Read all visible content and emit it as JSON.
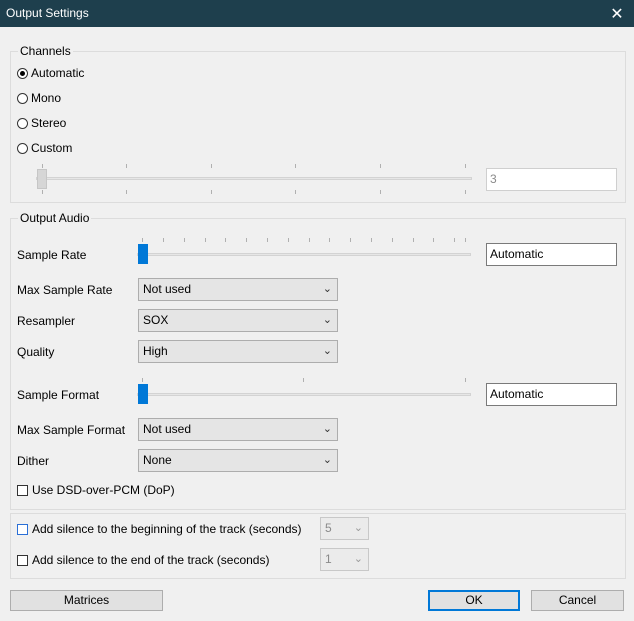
{
  "window": {
    "title": "Output Settings",
    "close_glyph": "✕"
  },
  "channels": {
    "legend": "Channels",
    "options": [
      {
        "label": "Automatic",
        "selected": true
      },
      {
        "label": "Mono",
        "selected": false
      },
      {
        "label": "Stereo",
        "selected": false
      },
      {
        "label": "Custom",
        "selected": false
      }
    ],
    "custom_value": "3"
  },
  "output_audio": {
    "legend": "Output Audio",
    "sample_rate_label": "Sample Rate",
    "sample_rate_value": "Automatic",
    "max_sample_rate_label": "Max Sample Rate",
    "max_sample_rate_value": "Not used",
    "resampler_label": "Resampler",
    "resampler_value": "SOX",
    "quality_label": "Quality",
    "quality_value": "High",
    "sample_format_label": "Sample Format",
    "sample_format_value": "Automatic",
    "max_sample_format_label": "Max Sample Format",
    "max_sample_format_value": "Not used",
    "dither_label": "Dither",
    "dither_value": "None",
    "dop_label": "Use DSD-over-PCM (DoP)"
  },
  "silence": {
    "begin_label": "Add silence to the beginning of the track (seconds)",
    "begin_value": "5",
    "end_label": "Add silence to the end of the track (seconds)",
    "end_value": "1"
  },
  "buttons": {
    "matrices": "Matrices",
    "ok": "OK",
    "cancel": "Cancel"
  },
  "icons": {
    "dropdown": "chevron-down-icon",
    "close": "close-icon"
  },
  "colors": {
    "titlebar": "#1e3f4d",
    "accent": "#0078d7"
  }
}
